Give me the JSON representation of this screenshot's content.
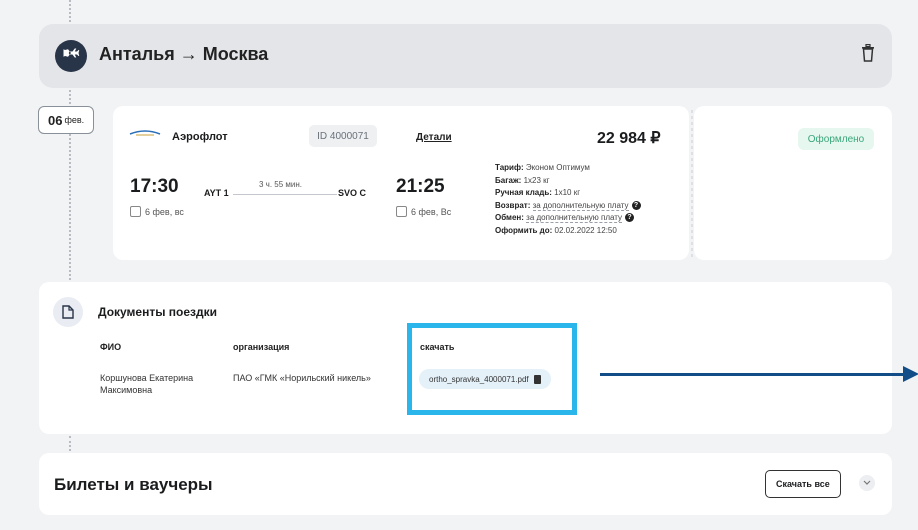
{
  "route": {
    "title": "Анталья → Москва"
  },
  "date_tag": {
    "day": "06",
    "month": "фев."
  },
  "flight": {
    "airline": "Аэрофлот",
    "ticket_id": "ID 4000071",
    "details_label": "Детали",
    "price": "22 984 ₽",
    "departure": {
      "time": "17:30",
      "code": "AYT 1",
      "date": "6 фев, вс"
    },
    "arrival": {
      "time": "21:25",
      "code": "SVO C",
      "date": "6 фев, Вс"
    },
    "duration": "3 ч. 55 мин.",
    "tariff": {
      "tariff_label": "Тариф:",
      "tariff_value": "Эконом Оптимум",
      "baggage_label": "Багаж:",
      "baggage_value": "1x23 кг",
      "hand_label": "Ручная кладь:",
      "hand_value": "1x10 кг",
      "return_label": "Возврат:",
      "return_value": "за дополнительную плату",
      "exchange_label": "Обмен:",
      "exchange_value": "за дополнительную плату",
      "deadline_label": "Оформить до:",
      "deadline_value": "02.02.2022 12:50"
    }
  },
  "status": {
    "label": "Оформлено"
  },
  "documents": {
    "title": "Документы поездки",
    "headers": {
      "name": "ФИО",
      "org": "организация",
      "download": "скачать"
    },
    "row": {
      "name": "Коршунова Екатерина Максимовна",
      "org": "ПАО «ГМК «Норильский никель»",
      "file": "ortho_spravka_4000071.pdf"
    }
  },
  "tickets": {
    "title": "Билеты и ваучеры",
    "download_all": "Скачать все"
  },
  "colors": {
    "highlight": "#2ab6ea",
    "arrow": "#134d88",
    "status": "#3aa67a"
  }
}
